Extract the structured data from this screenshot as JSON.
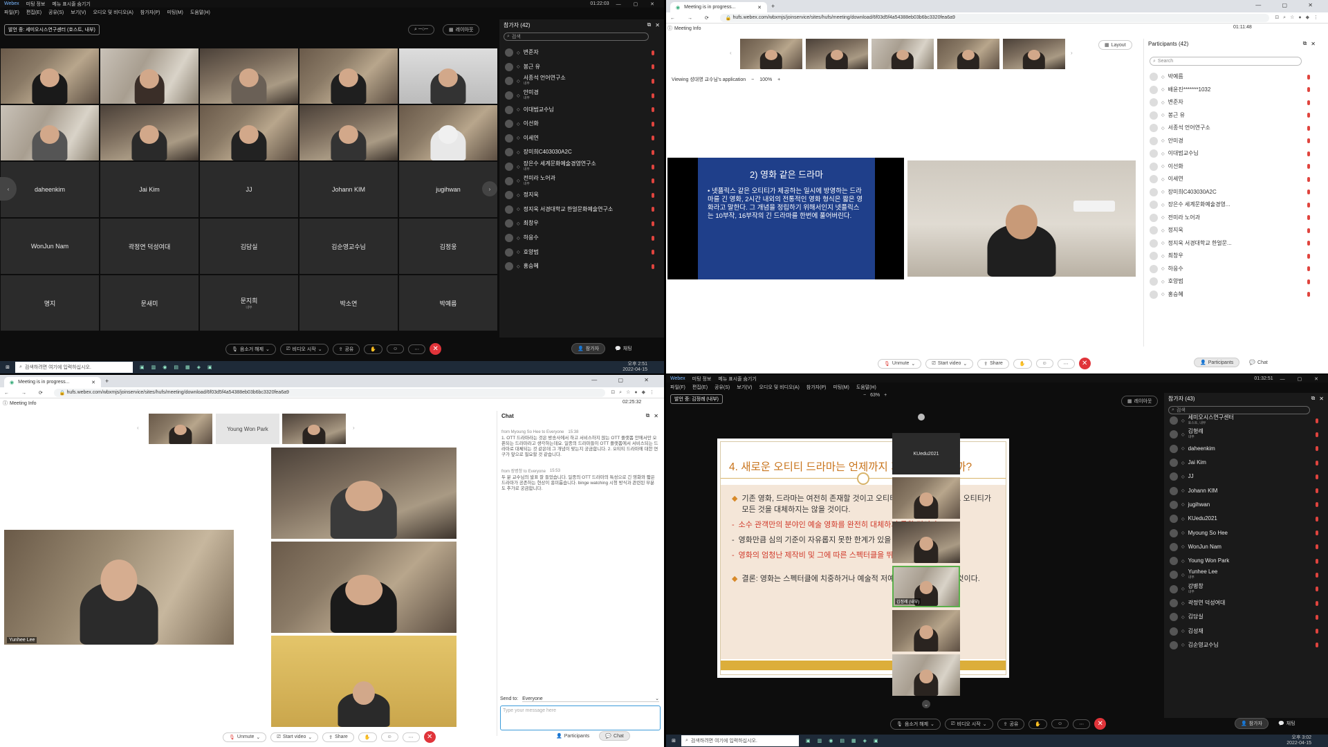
{
  "q1": {
    "app_name": "Webex",
    "menu_items": [
      "미팅 정보",
      "메뉴 표시줄 숨기기"
    ],
    "submenu": [
      "파일(F)",
      "편집(E)",
      "공유(S)",
      "보기(V)",
      "오디오 및 비디오(A)",
      "참가자(P)",
      "미팅(M)",
      "도움말(H)"
    ],
    "clock": "01:22:03",
    "presenter_badge": "발언 중: 세미오시스연구센터 (호스트, 내부)",
    "layout_label": "레이아웃",
    "grid_names": [
      "daheenkim",
      "Jai Kim",
      "JJ",
      "Johann KIM",
      "jugihwan",
      "WonJun Nam",
      "곽정연 덕성여대",
      "김담실",
      "김순영교수님",
      "김정웅",
      "명지",
      "문새미",
      "문지희",
      "박소연",
      "박예름"
    ],
    "grid_subs": [
      "",
      "",
      "",
      "",
      "",
      "",
      "",
      "",
      "",
      "",
      "",
      "",
      "내부",
      "",
      ""
    ],
    "participants_title": "참가자 (42)",
    "search_placeholder": "검색",
    "participants": [
      {
        "name": "변준자",
        "sub": ""
      },
      {
        "name": "봉근 유",
        "sub": ""
      },
      {
        "name": "서종석 언어연구소",
        "sub": "내부"
      },
      {
        "name": "안미경",
        "sub": "내부"
      },
      {
        "name": "이대범교수님",
        "sub": ""
      },
      {
        "name": "이선화",
        "sub": ""
      },
      {
        "name": "이세연",
        "sub": ""
      },
      {
        "name": "장미희C403030A2C",
        "sub": ""
      },
      {
        "name": "장은수 세계문화예술경영연구소",
        "sub": "내부"
      },
      {
        "name": "전미라 노어과",
        "sub": "내부"
      },
      {
        "name": "정지욱",
        "sub": ""
      },
      {
        "name": "정지욱 서경대학교 한얼문화예술연구소",
        "sub": ""
      },
      {
        "name": "최창우",
        "sub": ""
      },
      {
        "name": "하응수",
        "sub": ""
      },
      {
        "name": "호양범",
        "sub": ""
      },
      {
        "name": "홍승혜",
        "sub": ""
      }
    ],
    "controls": {
      "mute": "음소거 해제",
      "video": "비디오 시작",
      "share": "공유",
      "participants": "참가자",
      "chat": "채팅"
    },
    "taskbar_search": "검색하려면 여기에 입력하십시오.",
    "taskbar_time": "오후 2:51",
    "taskbar_date": "2022-04-15"
  },
  "q2": {
    "tab_title": "Meeting is in progress...",
    "url": "hufs.webex.com/wbxmjs/joinservice/sites/hufs/meeting/download/6f03d5f4a54388eb03b6bc3320fea6a9",
    "meeting_info": "Meeting Info",
    "clock": "01:11:48",
    "layout": "Layout",
    "viewing": "Viewing 성대영 교수님's application",
    "zoom": "100%",
    "slide_title": "2) 영화 같은 드라마",
    "slide_body": "• 넷플릭스 같은 오티티가 제공하는 일시에 방영하는 드라마를 긴 영화, 2시간 내외의 전통적인 영화 형식은 짧은 영화라고 말한다. 그 개념을 정립하기 위해서인지 넷플릭스는 10부작, 16부작의 긴 드라마를 한번에 풀어버린다.",
    "participants_title": "Participants (42)",
    "search_placeholder": "Search",
    "participants": [
      "박예름",
      "배윤진*******1032",
      "변준자",
      "봉근 유",
      "서종석 언어연구소",
      "안미경",
      "이대범교수님",
      "이선화",
      "이세연",
      "장미희C403030A2C",
      "장은수 세계문화예술경영...",
      "전미라 노어과",
      "정지욱",
      "정지욱 서경대학교 한얼문...",
      "최창우",
      "하응수",
      "호양범",
      "홍승혜"
    ],
    "controls": {
      "unmute": "Unmute",
      "video": "Start video",
      "share": "Share",
      "participants": "Participants",
      "chat": "Chat"
    }
  },
  "q3": {
    "tab_title": "Meeting is in progress...",
    "url": "hufs.webex.com/wbxmjs/joinservice/sites/hufs/meeting/download/6f03d5f4a54388eb03b6bc3320fea6a9",
    "meeting_info": "Meeting Info",
    "clock": "02:25:32",
    "thumb_name": "Young Won Park",
    "speaker_label": "Yunhee Lee",
    "chat_title": "Chat",
    "chat_messages": [
      {
        "from": "from Myoung So Hee to Everyone",
        "time": "15:38",
        "text": "1. OTT 드라마라는 것은 방송사에서 하고 서비스하지 않는 OTT 플랫폼 안에서만 오픈되는 드라마라고 생각하는데요. 일종의 드라마들이 OTT 플랫폼에서 서비스되는 드라마로 대체되는 것 같은데 그 개념이 맞는지 궁금합니다. 2. 오티티 드라마에 대한 연구가 앞으로 필요할 것 같습니다."
      },
      {
        "from": "from 장병창 to Everyone",
        "time": "15:53",
        "text": "두 분 교수님의 발표 잘 들었습니다. 일종의 OTT 드라마의 특성으로 긴 영화와 짧은 드라마가 공존하는 현상이 흥미롭습니다. binge watching 시청 방식과 관련된 부분도 추가로 궁금합니다."
      }
    ],
    "send_to_label": "Send to:",
    "send_to_value": "Everyone",
    "message_placeholder": "Type your message here",
    "controls": {
      "unmute": "Unmute",
      "video": "Start video",
      "share": "Share",
      "participants": "Participants",
      "chat": "Chat"
    }
  },
  "q4": {
    "app_name": "Webex",
    "menu_items": [
      "미팅 정보",
      "메뉴 표시줄 숨기기"
    ],
    "submenu": [
      "파일(F)",
      "편집(E)",
      "공유(S)",
      "보기(V)",
      "오디오 및 비디오(A)",
      "참가자(P)",
      "미팅(M)",
      "도움말(H)"
    ],
    "clock": "01:32:51",
    "presenter_badge": "발언 중: 김정례 (내부)",
    "zoom": "63%",
    "layout_label": "레이아웃",
    "side_name": "KUedu2021",
    "side_label": "김정례 (내부)",
    "slide_title": "4. 새로운 오티티 드라마는 언제까지 지속할 수 있을까?",
    "slide_points": [
      {
        "text": "기존 영화, 드라마는 여전히 존재할 것이고 오티티 역시 공존할 것이다. 오티티가 모든 것을 대체하지는 않을 것이다.",
        "style": "diamond"
      },
      {
        "text": "소수 관객만의 분야인 예술 영화를 완전히 대체하지 못할 것이다.",
        "style": "red"
      },
      {
        "text": "영화만큼 심의 기준이 자유롭지 못한 한계가 있을 것이다.",
        "style": "dash"
      },
      {
        "text": "영화의 엄청난 제작비 및 그에 따른 스펙터클을 뛰어넘지 못할 것이다.",
        "style": "red"
      },
      {
        "text": "결론: 영화는 스펙터클에 치중하거나 예술적 저예산 영화로 극단화될 것이다.",
        "style": "diamond"
      }
    ],
    "participants_title": "참가자 (43)",
    "search_placeholder": "검색",
    "participants": [
      {
        "name": "세미오시스연구센터",
        "sub": "호스트, 내부"
      },
      {
        "name": "김형례",
        "sub": "내부"
      },
      {
        "name": "daheenkim",
        "sub": ""
      },
      {
        "name": "Jai Kim",
        "sub": ""
      },
      {
        "name": "JJ",
        "sub": ""
      },
      {
        "name": "Johann KIM",
        "sub": ""
      },
      {
        "name": "jugihwan",
        "sub": ""
      },
      {
        "name": "KUedu2021",
        "sub": ""
      },
      {
        "name": "Myoung So Hee",
        "sub": ""
      },
      {
        "name": "WonJun Nam",
        "sub": ""
      },
      {
        "name": "Young Won Park",
        "sub": ""
      },
      {
        "name": "Yunhee Lee",
        "sub": "내부"
      },
      {
        "name": "강병창",
        "sub": "내부"
      },
      {
        "name": "곽정연 덕성여대",
        "sub": ""
      },
      {
        "name": "김담실",
        "sub": ""
      },
      {
        "name": "김성재",
        "sub": ""
      },
      {
        "name": "김순영교수님",
        "sub": ""
      }
    ],
    "controls": {
      "mute": "음소거 해제",
      "video": "비디오 시작",
      "share": "공유",
      "participants": "참가자",
      "chat": "채팅"
    },
    "taskbar_search": "검색하려면 여기에 입력하십시오.",
    "taskbar_time": "오후 3:02",
    "taskbar_date": "2022-04-15"
  }
}
